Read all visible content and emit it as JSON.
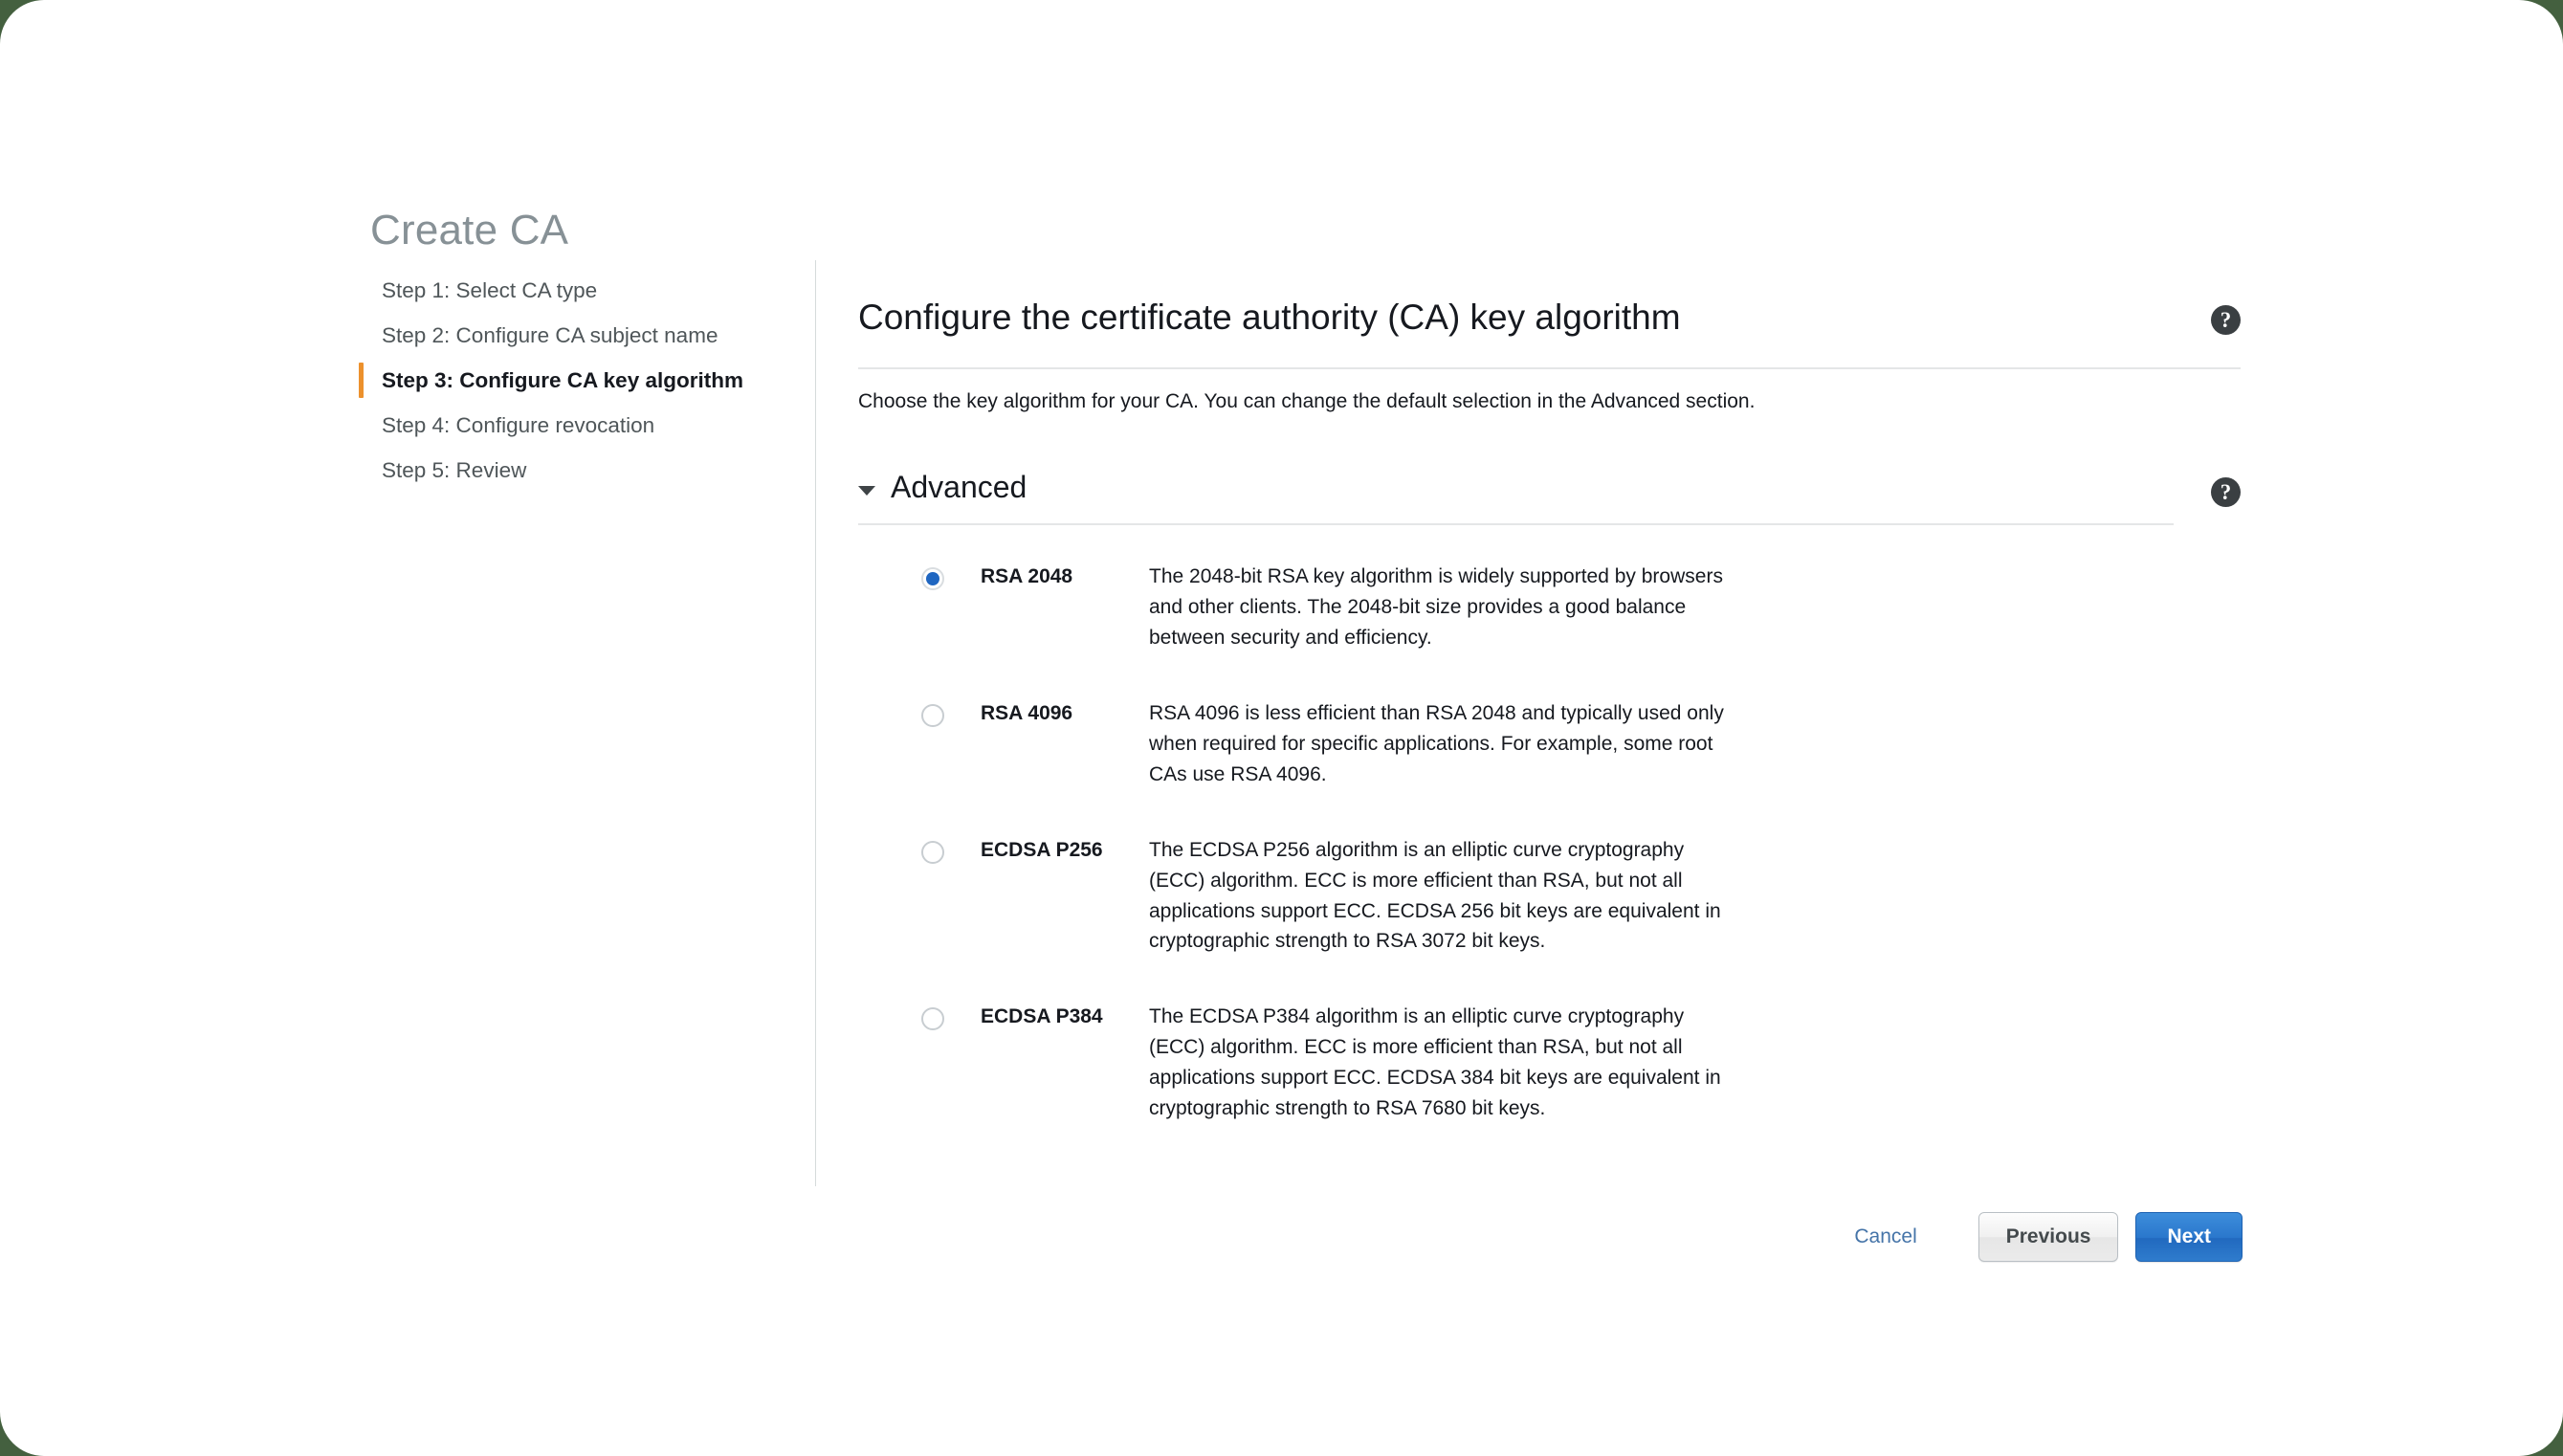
{
  "page": {
    "title": "Create CA"
  },
  "steps": [
    {
      "label": "Step 1: Select CA type",
      "active": false
    },
    {
      "label": "Step 2: Configure CA subject name",
      "active": false
    },
    {
      "label": "Step 3: Configure CA key algorithm",
      "active": true
    },
    {
      "label": "Step 4: Configure revocation",
      "active": false
    },
    {
      "label": "Step 5: Review",
      "active": false
    }
  ],
  "content": {
    "heading": "Configure the certificate authority (CA) key algorithm",
    "description": "Choose the key algorithm for your CA. You can change the default selection in the Advanced section.",
    "help_icon": "?",
    "help_icon_name": "help-icon"
  },
  "advanced": {
    "label": "Advanced",
    "expanded": true,
    "caret_icon": "chevron-down-icon",
    "help_icon": "?"
  },
  "key_algorithm": {
    "selected": "RSA 2048",
    "options": [
      {
        "name": "RSA 2048",
        "description": "The 2048-bit RSA key algorithm is widely supported by browsers and other clients. The 2048-bit size provides a good balance between security and efficiency.",
        "selected": true
      },
      {
        "name": "RSA 4096",
        "description": "RSA 4096 is less efficient than RSA 2048 and typically used only when required for specific applications. For example, some root CAs use RSA 4096.",
        "selected": false
      },
      {
        "name": "ECDSA P256",
        "description": "The ECDSA P256 algorithm is an elliptic curve cryptography (ECC) algorithm. ECC is more efficient than RSA, but not all applications support ECC. ECDSA 256 bit keys are equivalent in cryptographic strength to RSA 3072 bit keys.",
        "selected": false
      },
      {
        "name": "ECDSA P384",
        "description": "The ECDSA P384 algorithm is an elliptic curve cryptography (ECC) algorithm. ECC is more efficient than RSA, but not all applications support ECC. ECDSA 384 bit keys are equivalent in cryptographic strength to RSA 7680 bit keys.",
        "selected": false
      }
    ]
  },
  "footer": {
    "cancel_label": "Cancel",
    "previous_label": "Previous",
    "next_label": "Next"
  },
  "colors": {
    "accent_orange": "#ec912d",
    "radio_blue": "#1f66c1",
    "link_blue": "#4574a8",
    "next_button_blue": "#2a77cc",
    "title_gray": "#879196",
    "text_dark": "#16191f",
    "divider": "#e4e6e7",
    "backdrop": "#44603f"
  }
}
